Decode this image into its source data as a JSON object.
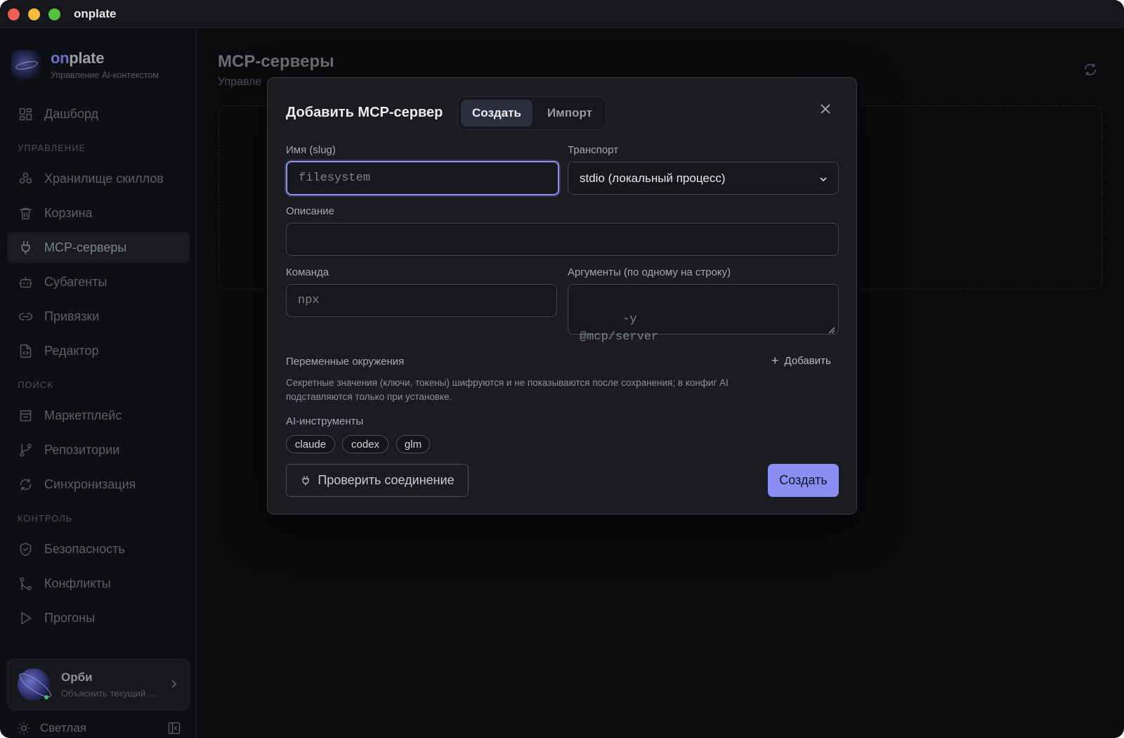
{
  "window": {
    "title": "onplate"
  },
  "brand": {
    "name_accent": "on",
    "name_rest": "plate",
    "subtitle": "Управление AI-контекстом"
  },
  "sidebar": {
    "top_item": {
      "label": "Дашборд",
      "icon": "dashboard-icon"
    },
    "sections": [
      {
        "label": "УПРАВЛЕНИЕ",
        "items": [
          {
            "label": "Хранилище скиллов",
            "icon": "blocks-icon"
          },
          {
            "label": "Корзина",
            "icon": "trash-icon"
          },
          {
            "label": "MCP-серверы",
            "icon": "plug-icon",
            "active": true
          },
          {
            "label": "Субагенты",
            "icon": "bot-icon"
          },
          {
            "label": "Привязки",
            "icon": "link-icon"
          },
          {
            "label": "Редактор",
            "icon": "file-code-icon"
          }
        ]
      },
      {
        "label": "ПОИСК",
        "items": [
          {
            "label": "Маркетплейс",
            "icon": "store-icon"
          },
          {
            "label": "Репозитории",
            "icon": "git-branch-icon"
          },
          {
            "label": "Синхронизация",
            "icon": "sync-icon"
          }
        ]
      },
      {
        "label": "КОНТРОЛЬ",
        "items": [
          {
            "label": "Безопасность",
            "icon": "shield-icon"
          },
          {
            "label": "Конфликты",
            "icon": "git-merge-icon"
          },
          {
            "label": "Прогоны",
            "icon": "play-icon"
          }
        ]
      }
    ],
    "orbi": {
      "name": "Орби",
      "subtitle": "Объяснить текущий ..."
    },
    "theme_label": "Светлая"
  },
  "main": {
    "title": "MCP-серверы",
    "subtitle": "Управле"
  },
  "modal": {
    "title": "Добавить MCP-сервер",
    "tabs": [
      {
        "label": "Создать",
        "active": true
      },
      {
        "label": "Импорт",
        "active": false
      }
    ],
    "name_label": "Имя (slug)",
    "name_placeholder": "filesystem",
    "transport_label": "Транспорт",
    "transport_value": "stdio (локальный процесс)",
    "description_label": "Описание",
    "description_value": "",
    "command_label": "Команда",
    "command_placeholder": "npx",
    "args_label": "Аргументы (по одному на строку)",
    "args_placeholder": "-y\n@mcp/server",
    "env_label": "Переменные окружения",
    "env_add": "Добавить",
    "secret_note": "Секретные значения (ключи, токены) шифруются и не показываются после сохранения; в конфиг AI подставляются только при установке.",
    "ai_tools_label": "AI-инструменты",
    "ai_tools": [
      "claude",
      "codex",
      "glm"
    ],
    "check_button": "Проверить соединение",
    "create_button": "Создать"
  }
}
